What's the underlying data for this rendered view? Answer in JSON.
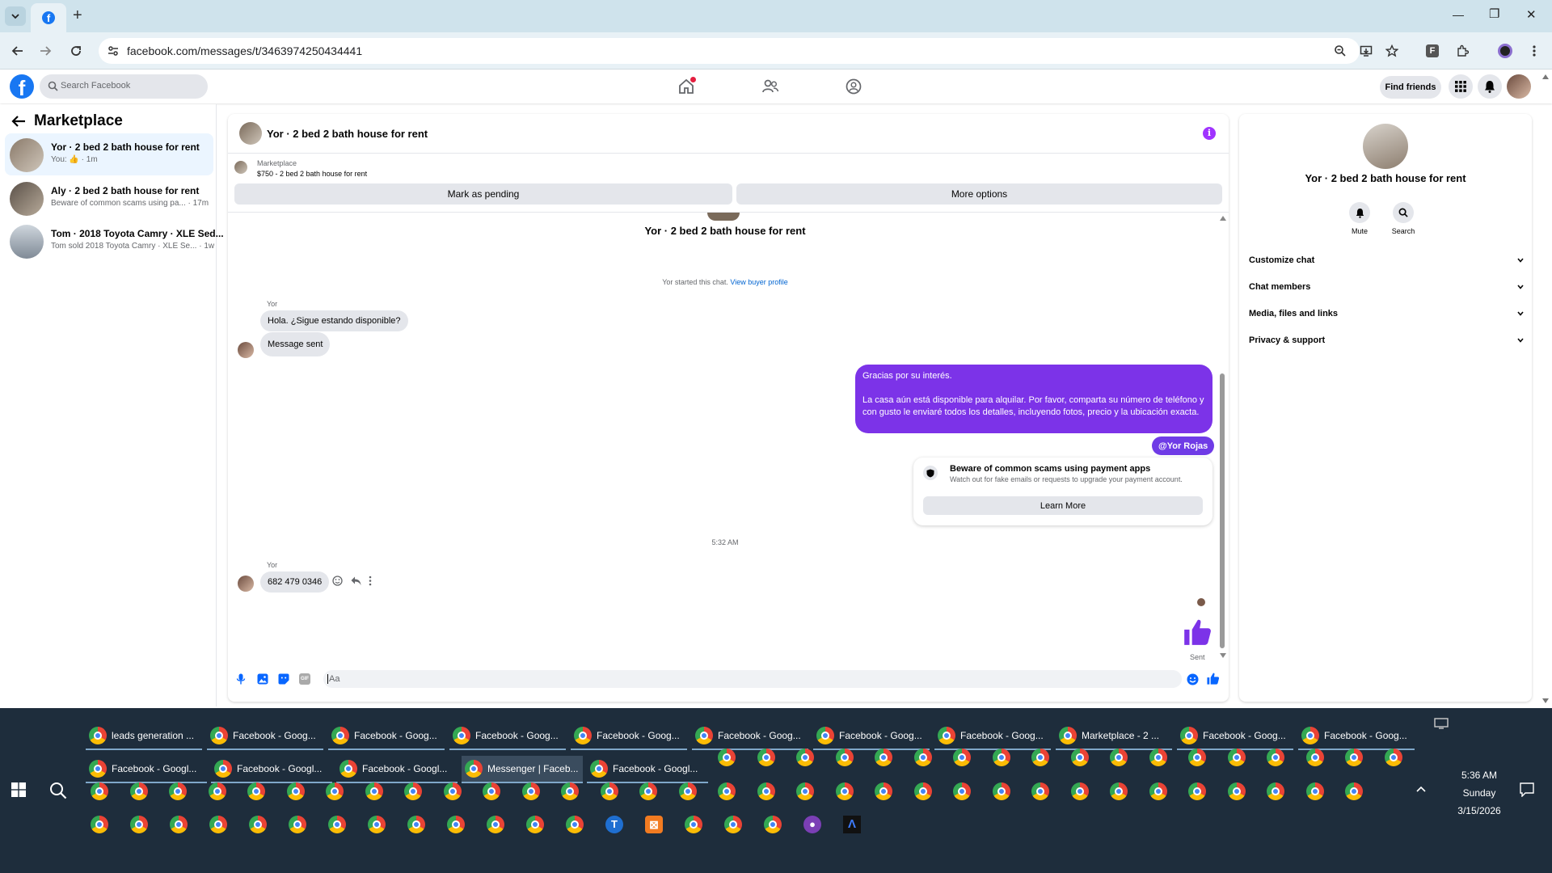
{
  "browser": {
    "url": "facebook.com/messages/t/3463974250434441",
    "new_tab": "+",
    "min": "—",
    "max": "❐",
    "close": "✕"
  },
  "fb": {
    "search_placeholder": "Search Facebook",
    "find_friends": "Find friends"
  },
  "sidebar": {
    "title": "Marketplace",
    "items": [
      {
        "title": "Yor · 2 bed 2 bath house for rent",
        "sub": "You: 👍 · 1m"
      },
      {
        "title": "Aly · 2 bed 2 bath house for rent",
        "sub": "Beware of common scams using pa... · 17m"
      },
      {
        "title": "Tom · 2018 Toyota Camry · XLE Sed...",
        "sub": "Tom sold 2018 Toyota Camry · XLE Se... · 1w"
      }
    ]
  },
  "chat": {
    "header_title": "Yor · 2 bed 2 bath house for rent",
    "listing_label": "Marketplace",
    "listing_title": "$750 - 2 bed 2 bath house for rent",
    "mark_pending": "Mark as pending",
    "more_options": "More options",
    "thread_title": "Yor · 2 bed 2 bath house for rent",
    "started_text": "Yor started this chat.",
    "view_profile": "View buyer profile",
    "sender_name": "Yor",
    "msg1": "Hola. ¿Sigue estando disponible?",
    "msg2": "Message sent",
    "out_line1": "Gracias por su interés.",
    "out_line2": "La casa aún está disponible para alquilar. Por favor, comparta su número de teléfono y con gusto le enviaré todos los detalles, incluyendo fotos, precio y la ubicación exacta.",
    "mention": "@Yor Rojas",
    "scam_title": "Beware of common scams using payment apps",
    "scam_sub": "Watch out for fake emails or requests to upgrade your payment account.",
    "learn_more": "Learn More",
    "timestamp": "5:32 AM",
    "sender_name2": "Yor",
    "phone": "682 479 0346",
    "sent": "Sent",
    "composer_placeholder": "Aa"
  },
  "info": {
    "title": "Yor · 2 bed 2 bath house for rent",
    "mute": "Mute",
    "search": "Search",
    "sections": [
      "Customize chat",
      "Chat members",
      "Media, files and links",
      "Privacy & support"
    ]
  },
  "taskbar": {
    "row1": [
      "leads generation ...",
      "Facebook - Goog...",
      "Facebook - Goog...",
      "Facebook - Goog...",
      "Facebook - Goog...",
      "Facebook - Goog...",
      "Facebook - Goog...",
      "Facebook - Goog...",
      "Marketplace - 2 ...",
      "Facebook - Goog...",
      "Facebook - Goog..."
    ],
    "row2": [
      "Facebook - Googl...",
      "Facebook - Googl...",
      "Facebook - Googl...",
      "Messenger | Faceb...",
      "Facebook - Googl..."
    ],
    "time": "5:36 AM",
    "day": "Sunday",
    "date": "3/15/2026"
  }
}
